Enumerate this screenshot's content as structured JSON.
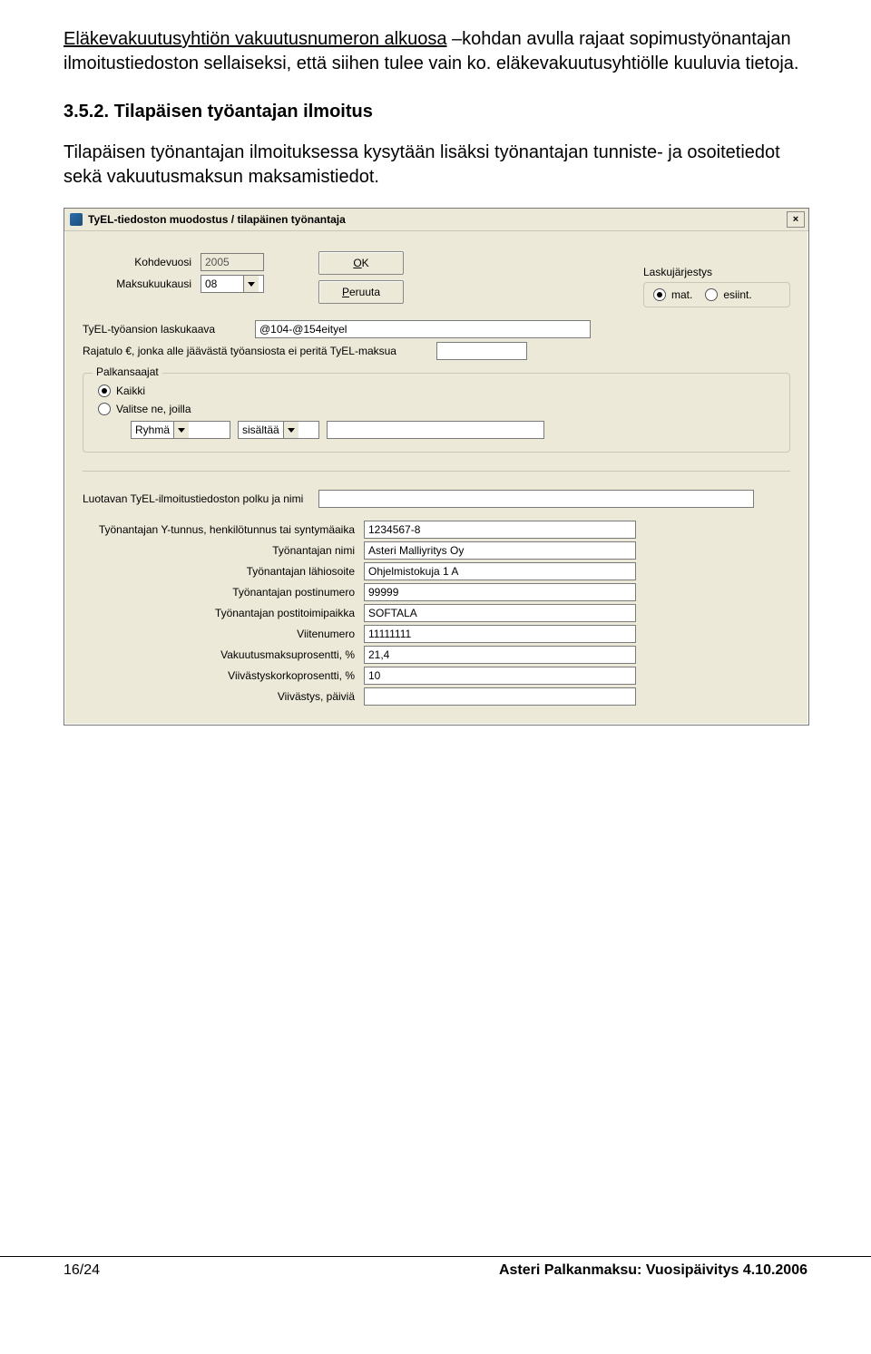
{
  "intro": {
    "underlined": "Eläkevakuutusyhtiön vakuutusnumeron alkuosa",
    "rest1": " –kohdan avulla rajaat sopimustyönantajan ilmoitustiedoston sellaiseksi, että siihen tulee vain ko. eläkevakuutusyhtiölle kuuluvia tietoja."
  },
  "section": {
    "num": "3.5.2. Tilapäisen työantajan ilmoitus",
    "text": "Tilapäisen työnantajan ilmoituksessa kysytään lisäksi työnantajan tunniste- ja osoitetiedot sekä vakuutusmaksun maksamistiedot."
  },
  "dialog": {
    "title": "TyEL-tiedoston muodostus / tilapäinen työnantaja",
    "close": "×",
    "kohdevuosi_label": "Kohdevuosi",
    "kohdevuosi_value": "2005",
    "maksukuukausi_label": "Maksukuukausi",
    "maksukuukausi_value": "08",
    "ok": "OK",
    "ok_u": "O",
    "ok_rest": "K",
    "peruuta": "Peruuta",
    "peruuta_u": "P",
    "peruuta_rest": "eruuta",
    "laskujarjestys_label": "Laskujärjestys",
    "lj_mat": "mat.",
    "lj_esint": "esiint.",
    "laskukaava_label": "TyEL-työansion laskukaava",
    "laskukaava_value": "@104-@154eityel",
    "rajatulo_label": "Rajatulo €, jonka alle jäävästä työansiosta ei peritä TyEL-maksua",
    "palkansaajat_legend": "Palkansaajat",
    "kaikki": "Kaikki",
    "valitse": "Valitse ne, joilla",
    "filter_field": "Ryhmä",
    "filter_op": "sisältää",
    "polku_label": "Luotavan TyEL-ilmoitustiedoston polku ja nimi",
    "details": [
      {
        "label": "Työnantajan Y-tunnus, henkilötunnus tai syntymäaika",
        "value": "1234567-8"
      },
      {
        "label": "Työnantajan nimi",
        "value": "Asteri Malliyritys Oy"
      },
      {
        "label": "Työnantajan lähiosoite",
        "value": "Ohjelmistokuja 1 A"
      },
      {
        "label": "Työnantajan postinumero",
        "value": "99999"
      },
      {
        "label": "Työnantajan postitoimipaikka",
        "value": "SOFTALA"
      },
      {
        "label": "Viitenumero",
        "value": "11111111"
      },
      {
        "label": "Vakuutusmaksuprosentti, %",
        "value": "21,4"
      },
      {
        "label": "Viivästyskorkoprosentti, %",
        "value": "10"
      },
      {
        "label": "Viivästys, päiviä",
        "value": ""
      }
    ]
  },
  "footer": {
    "left": "16/24",
    "right": "Asteri Palkanmaksu: Vuosipäivitys 4.10.2006"
  }
}
